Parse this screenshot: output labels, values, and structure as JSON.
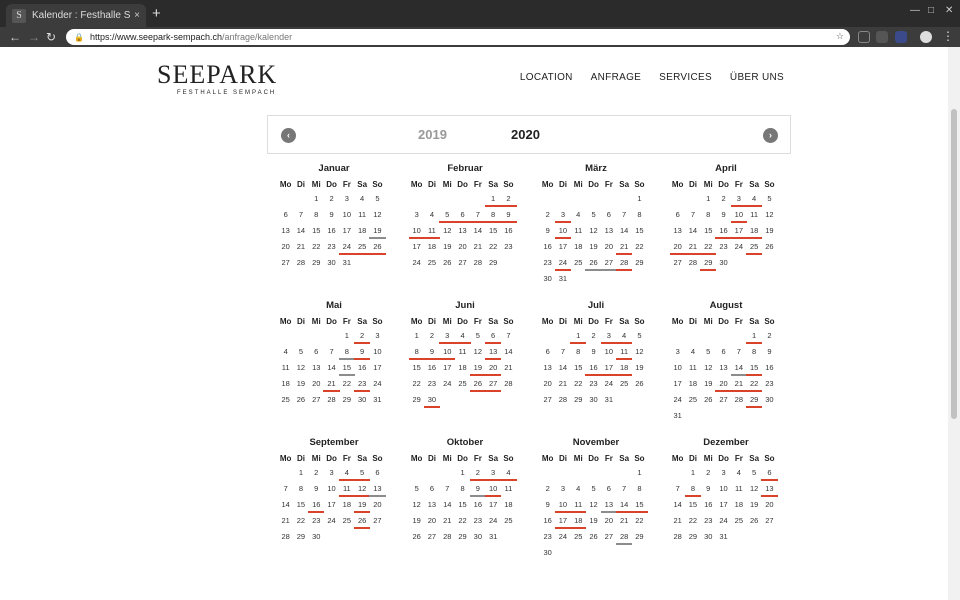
{
  "browser": {
    "tab_title": "Kalender : Festhalle SEEP",
    "tab_close": "×",
    "new_tab": "+",
    "url_host": "https://www.seepark-sempach.ch",
    "url_path": "/anfrage/kalender"
  },
  "logo": {
    "main": "SEEPARK",
    "sub": "FESTHALLE SEMPACH"
  },
  "nav": [
    "LOCATION",
    "ANFRAGE",
    "SERVICES",
    "ÜBER UNS"
  ],
  "years": {
    "previous": "2019",
    "current": "2020"
  },
  "weekdays": [
    "Mo",
    "Di",
    "Mi",
    "Do",
    "Fr",
    "Sa",
    "So"
  ],
  "colors": {
    "booked": "#d8432a",
    "reserved": "#8c8c8c"
  },
  "months": [
    {
      "name": "Januar",
      "offset": 2,
      "days": 31,
      "booked": [
        24,
        25,
        26
      ],
      "reserved": [
        19
      ]
    },
    {
      "name": "Februar",
      "offset": 5,
      "days": 29,
      "booked": [
        1,
        2,
        5,
        6,
        7,
        8,
        9,
        10,
        11
      ],
      "reserved": []
    },
    {
      "name": "März",
      "offset": 6,
      "days": 31,
      "booked": [
        3,
        10,
        21,
        24,
        28
      ],
      "reserved": [
        26,
        27
      ]
    },
    {
      "name": "April",
      "offset": 2,
      "days": 30,
      "booked": [
        3,
        4,
        10,
        16,
        17,
        18,
        20,
        21,
        22,
        25,
        29
      ],
      "reserved": []
    },
    {
      "name": "Mai",
      "offset": 4,
      "days": 31,
      "booked": [
        2,
        9,
        21,
        23
      ],
      "reserved": [
        8,
        15
      ]
    },
    {
      "name": "Juni",
      "offset": 0,
      "days": 30,
      "booked": [
        3,
        4,
        6,
        8,
        9,
        10,
        13,
        19,
        20,
        26,
        27,
        30
      ],
      "reserved": []
    },
    {
      "name": "Juli",
      "offset": 2,
      "days": 31,
      "booked": [
        1,
        3,
        4,
        11,
        16,
        17,
        18
      ],
      "reserved": []
    },
    {
      "name": "August",
      "offset": 5,
      "days": 31,
      "booked": [
        1,
        15,
        20,
        21,
        22,
        29
      ],
      "reserved": [
        14
      ]
    },
    {
      "name": "September",
      "offset": 1,
      "days": 30,
      "booked": [
        4,
        5,
        11,
        12,
        16,
        19,
        26
      ],
      "reserved": [
        13
      ]
    },
    {
      "name": "Oktober",
      "offset": 3,
      "days": 31,
      "booked": [
        2,
        3,
        4,
        10
      ],
      "reserved": [
        9
      ]
    },
    {
      "name": "November",
      "offset": 6,
      "days": 30,
      "booked": [
        10,
        11,
        14,
        15,
        17,
        18
      ],
      "reserved": [
        13,
        28
      ]
    },
    {
      "name": "Dezember",
      "offset": 1,
      "days": 31,
      "booked": [
        6,
        8,
        13
      ],
      "reserved": []
    }
  ]
}
